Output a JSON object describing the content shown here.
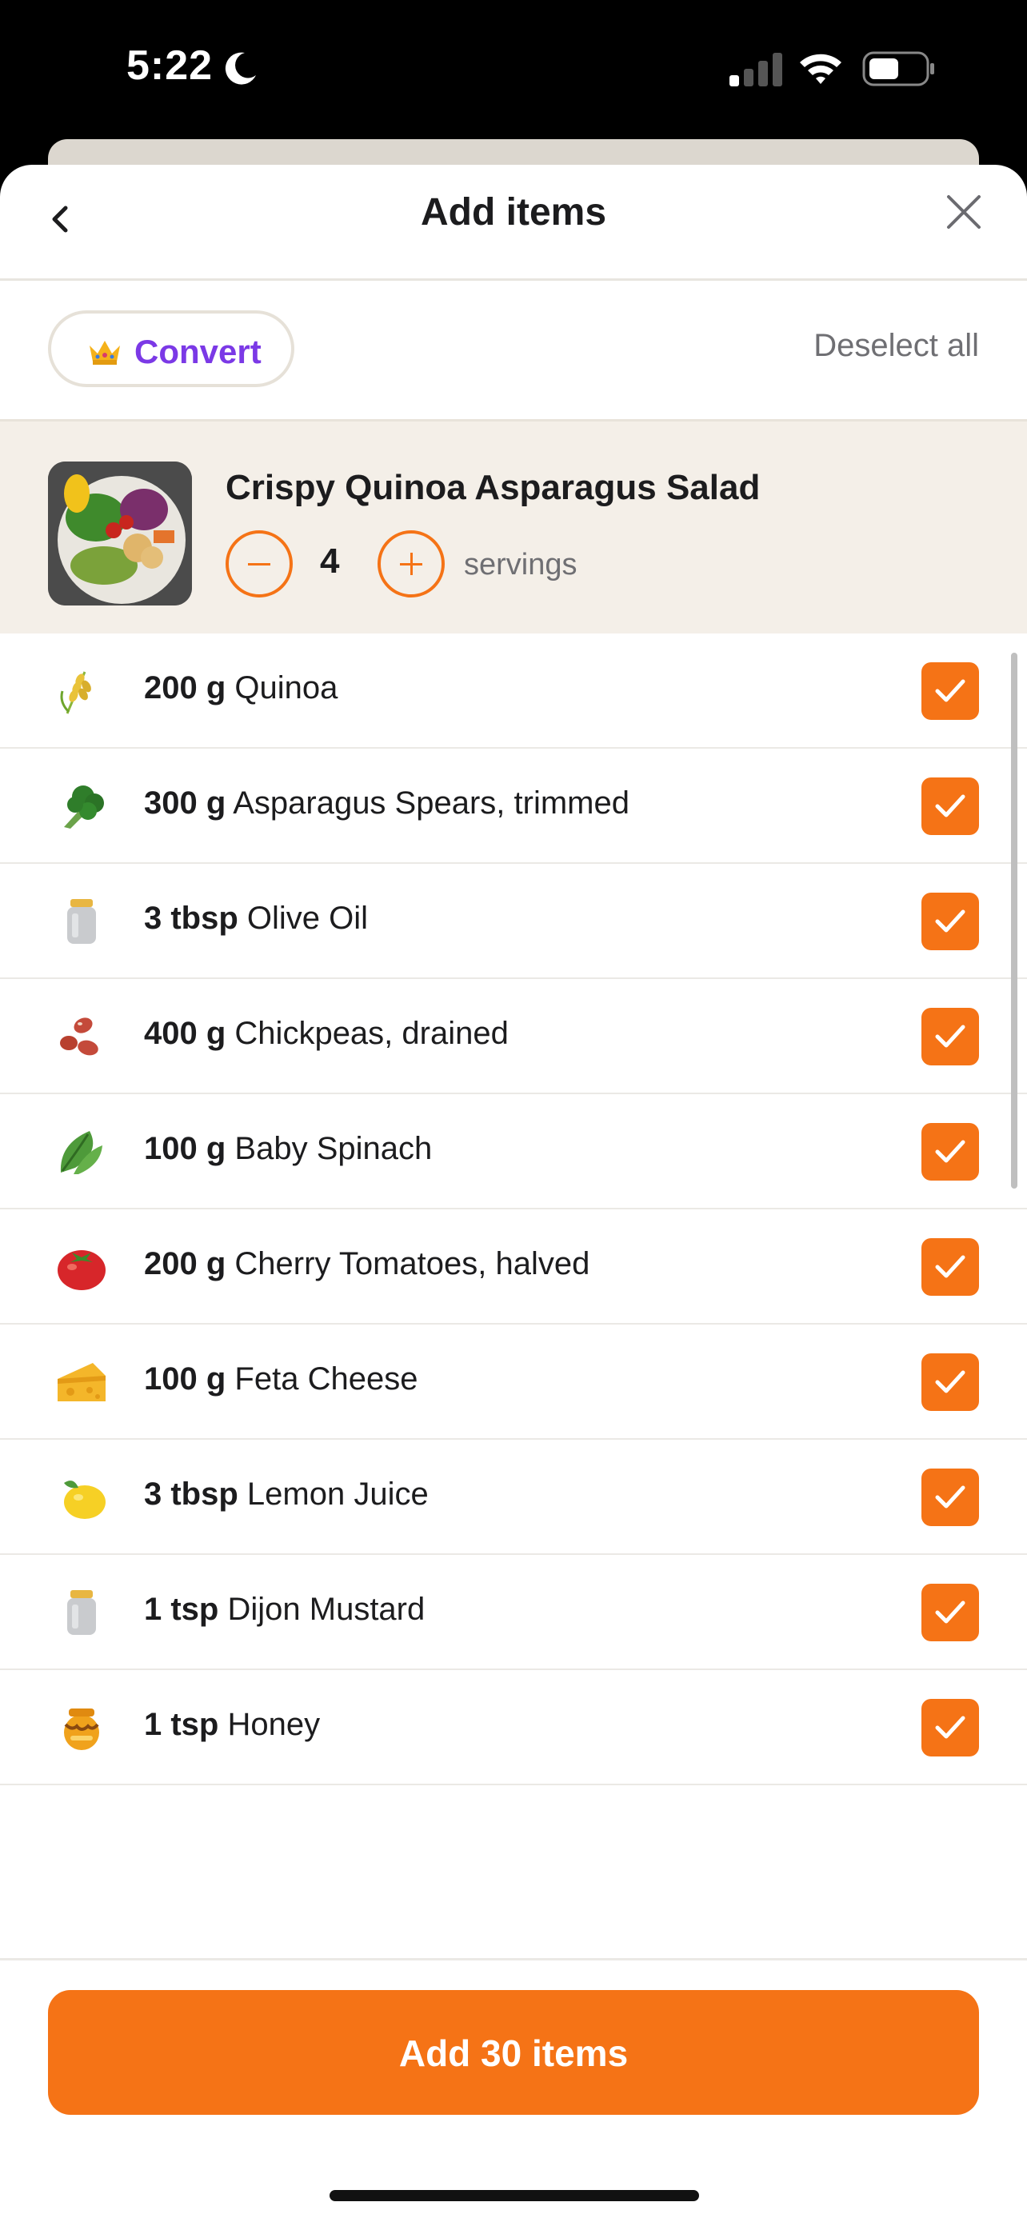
{
  "status_bar": {
    "time": "5:22"
  },
  "nav": {
    "title": "Add items"
  },
  "toolbar": {
    "convert_label": "Convert",
    "deselect_label": "Deselect all"
  },
  "recipe": {
    "title": "Crispy Quinoa Asparagus Salad",
    "servings": "4",
    "servings_label": "servings"
  },
  "items": [
    {
      "qty": "200 g",
      "name": "Quinoa",
      "icon": "grain-icon",
      "checked": true
    },
    {
      "qty": "300 g",
      "name": "Asparagus Spears, trimmed",
      "icon": "broccoli-icon",
      "checked": true
    },
    {
      "qty": "3 tbsp",
      "name": "Olive Oil",
      "icon": "jar-icon",
      "checked": true
    },
    {
      "qty": "400 g",
      "name": "Chickpeas, drained",
      "icon": "beans-icon",
      "checked": true
    },
    {
      "qty": "100 g",
      "name": "Baby Spinach",
      "icon": "leafy-greens-icon",
      "checked": true
    },
    {
      "qty": "200 g",
      "name": "Cherry Tomatoes, halved",
      "icon": "tomato-icon",
      "checked": true
    },
    {
      "qty": "100 g",
      "name": "Feta Cheese",
      "icon": "cheese-icon",
      "checked": true
    },
    {
      "qty": "3 tbsp",
      "name": "Lemon Juice",
      "icon": "lemon-icon",
      "checked": true
    },
    {
      "qty": "1 tsp",
      "name": "Dijon Mustard",
      "icon": "jar-icon",
      "checked": true
    },
    {
      "qty": "1 tsp",
      "name": "Honey",
      "icon": "honey-pot-icon",
      "checked": true
    }
  ],
  "footer": {
    "add_button_label": "Add 30 items"
  },
  "colors": {
    "accent": "#f57316",
    "convert_purple": "#7b39e6",
    "header_bg": "#f4efe8"
  }
}
